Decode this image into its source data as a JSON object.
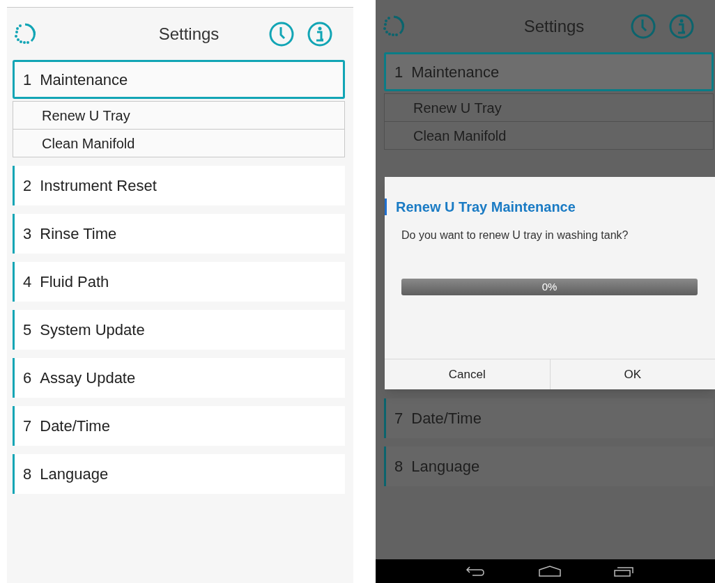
{
  "screens": [
    {
      "title": "Settings",
      "items": [
        {
          "number": "1",
          "label": "Maintenance",
          "selected": true,
          "children": [
            {
              "label": "Renew U Tray"
            },
            {
              "label": "Clean Manifold"
            }
          ]
        },
        {
          "number": "2",
          "label": "Instrument Reset",
          "selected": false
        },
        {
          "number": "3",
          "label": "Rinse Time",
          "selected": false
        },
        {
          "number": "4",
          "label": "Fluid Path",
          "selected": false
        },
        {
          "number": "5",
          "label": "System Update",
          "selected": false
        },
        {
          "number": "6",
          "label": "Assay Update",
          "selected": false
        },
        {
          "number": "7",
          "label": "Date/Time",
          "selected": false
        },
        {
          "number": "8",
          "label": "Language",
          "selected": false
        }
      ]
    },
    {
      "title": "Settings",
      "dimmed": true,
      "nav_bar": true,
      "items": [
        {
          "number": "1",
          "label": "Maintenance",
          "selected": true,
          "children": [
            {
              "label": "Renew U Tray"
            },
            {
              "label": "Clean Manifold"
            }
          ]
        },
        {
          "number": "7",
          "label": "Date/Time",
          "selected": false
        },
        {
          "number": "8",
          "label": "Language",
          "selected": false
        }
      ],
      "dialog": {
        "title": "Renew U Tray Maintenance",
        "message": "Do you want to renew U tray in washing tank?",
        "progress": {
          "level": 0,
          "label": "0%"
        },
        "buttons": [
          "Cancel",
          "OK"
        ]
      }
    }
  ]
}
